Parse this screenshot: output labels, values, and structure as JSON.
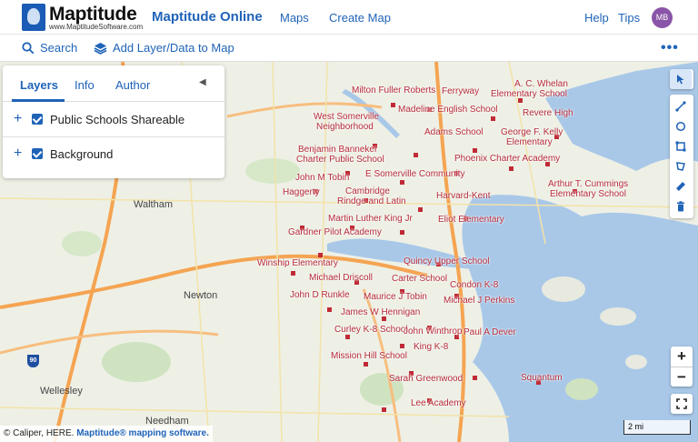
{
  "header": {
    "brand": "Maptitude",
    "brand_url": "www.MaptitudeSoftware.com",
    "product": "Maptitude Online",
    "nav": [
      "Maps",
      "Create Map"
    ],
    "help": "Help",
    "tips": "Tips",
    "user_initials": "MB"
  },
  "toolbar": {
    "search": "Search",
    "add_layer": "Add Layer/Data to Map",
    "more": "•••"
  },
  "panel": {
    "tabs": [
      "Layers",
      "Info",
      "Author"
    ],
    "layers": [
      "Public Schools Shareable",
      "Background"
    ]
  },
  "map": {
    "places": [
      "Waltham",
      "Newton",
      "Wellesley",
      "Needham"
    ],
    "highway_shield": "90",
    "schools": [
      "Milton Fuller Roberts",
      "Ferryway",
      "A. C. Whelan",
      "Elementary School",
      "West Somerville",
      "Neighborhood",
      "Madeline English School",
      "Revere High",
      "Adams School",
      "George F. Kelly",
      "Elementary",
      "Benjamin Banneker",
      "Charter Public School",
      "Phoenix Charter Academy",
      "John M Tobin",
      "E Somerville Community",
      "Arthur T. Cummings",
      "Elementary School",
      "Haggerty",
      "Cambridge",
      "Rindge and Latin",
      "Harvard-Kent",
      "Martin Luther King Jr",
      "Eliot Elementary",
      "Gardner Pilot Academy",
      "Quincy Upper School",
      "Winship Elementary",
      "Carter School",
      "Michael Driscoll",
      "Condon K-8",
      "John D Runkle",
      "Maurice J Tobin",
      "Michael J Perkins",
      "James W Hennigan",
      "Curley K-8 School",
      "John Winthrop",
      "Paul A Dever",
      "King K-8",
      "Mission Hill School",
      "Sarah Greenwood",
      "Squantum",
      "Lee Academy"
    ]
  },
  "attribution": {
    "text": "© Caliper, HERE.",
    "link": "Maptitude® mapping software."
  },
  "scale": "2 mi"
}
